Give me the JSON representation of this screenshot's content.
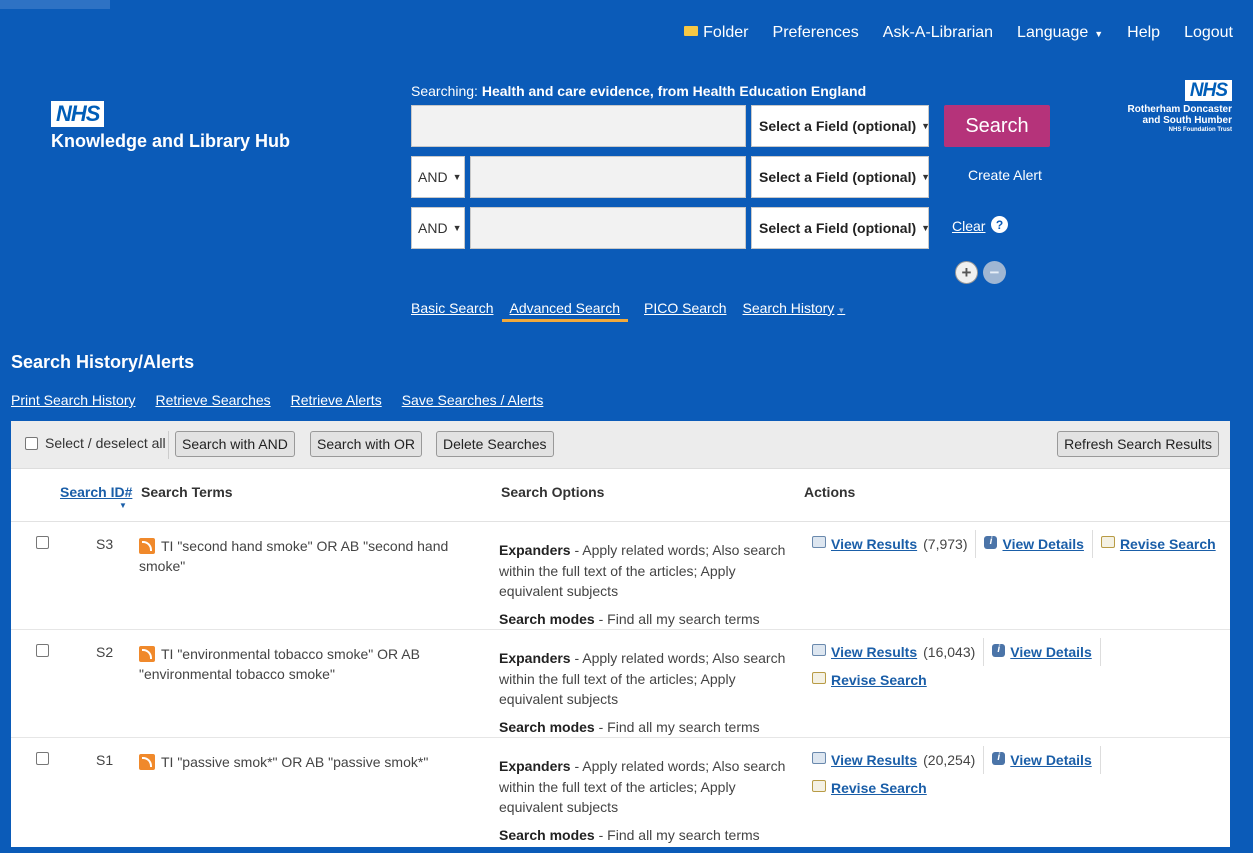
{
  "topnav": {
    "folder": "Folder",
    "preferences": "Preferences",
    "ask": "Ask-A-Librarian",
    "language": "Language",
    "help": "Help",
    "logout": "Logout"
  },
  "branding": {
    "nhs": "NHS",
    "hub": "Knowledge and Library Hub",
    "trust_line1": "Rotherham Doncaster",
    "trust_line2": "and South Humber",
    "trust_line3": "NHS Foundation Trust"
  },
  "search": {
    "searching_label": "Searching:",
    "searching_db": "Health and care evidence, from Health Education England",
    "field_placeholder": "Select a Field (optional)",
    "bool_op": "AND",
    "search_button": "Search",
    "create_alert": "Create Alert",
    "clear": "Clear",
    "help": "?",
    "plus": "+",
    "minus": "−"
  },
  "subnav": {
    "basic": "Basic Search",
    "advanced": "Advanced Search",
    "pico": "PICO Search",
    "history": "Search History"
  },
  "history": {
    "title": "Search History/Alerts",
    "print": "Print Search History",
    "retrieve_searches": "Retrieve Searches",
    "retrieve_alerts": "Retrieve Alerts",
    "save": "Save Searches / Alerts",
    "select_all": "Select / deselect all",
    "search_and": "Search with AND",
    "search_or": "Search with OR",
    "delete": "Delete Searches",
    "refresh": "Refresh Search Results",
    "col_id": "Search ID#",
    "col_terms": "Search Terms",
    "col_options": "Search Options",
    "col_actions": "Actions",
    "expanders_label": "Expanders",
    "modes_label": "Search modes",
    "view_results": "View Results",
    "view_details": "View Details",
    "revise": "Revise Search",
    "rows": [
      {
        "id": "S3",
        "terms": "TI \"second hand smoke\" OR AB \"second hand smoke\"",
        "expanders": " - Apply related words; Also search within the full text of the articles; Apply equivalent subjects",
        "modes": " - Find all my search terms",
        "count": "(7,973)"
      },
      {
        "id": "S2",
        "terms": "TI \"environmental tobacco smoke\" OR AB \"environmental tobacco smoke\"",
        "expanders": " - Apply related words; Also search within the full text of the articles; Apply equivalent subjects",
        "modes": " - Find all my search terms",
        "count": "(16,043)"
      },
      {
        "id": "S1",
        "terms": "TI \"passive smok*\" OR AB \"passive smok*\"",
        "expanders": " - Apply related words; Also search within the full text of the articles; Apply equivalent subjects",
        "modes": " - Find all my search terms",
        "count": "(20,254)"
      }
    ]
  }
}
